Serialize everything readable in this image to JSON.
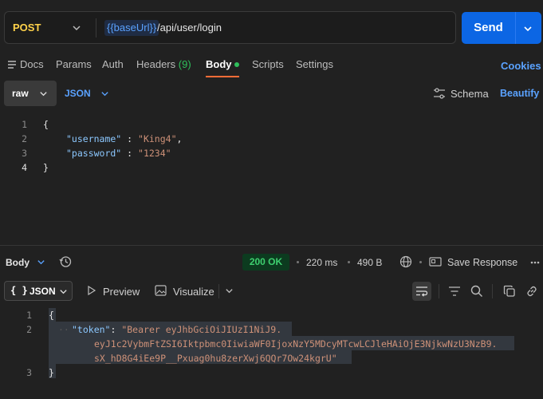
{
  "request": {
    "method": "POST",
    "url_variable": "{{baseUrl}}",
    "url_path": "/api/user/login",
    "send_label": "Send"
  },
  "tabs": {
    "docs": "Docs",
    "params": "Params",
    "auth": "Auth",
    "headers": "Headers",
    "headers_count": "(9)",
    "body": "Body",
    "scripts": "Scripts",
    "settings": "Settings",
    "cookies": "Cookies"
  },
  "body_options": {
    "mode": "raw",
    "format": "JSON",
    "schema": "Schema",
    "beautify": "Beautify"
  },
  "request_body": {
    "line_numbers": [
      "1",
      "2",
      "3",
      "4"
    ],
    "open_brace": "{",
    "username_key": "\"username\"",
    "username_value": "\"King4\"",
    "password_key": "\"password\"",
    "password_value": "\"1234\"",
    "sep": " : ",
    "comma": ",",
    "close_brace": "}"
  },
  "response_bar": {
    "label": "Body",
    "status": "200 OK",
    "time": "220 ms",
    "size": "490 B",
    "save_response": "Save Response"
  },
  "response_view": {
    "format": "JSON",
    "braces": "{ }",
    "preview": "Preview",
    "visualize": "Visualize"
  },
  "response_body": {
    "line_numbers": [
      "1",
      "2",
      "3"
    ],
    "open_brace": "{",
    "token_key": "\"token\"",
    "colon": ": ",
    "token_line1": "\"Bearer eyJhbGciOiJIUzI1NiJ9.",
    "token_line2": "eyJ1c2VybmFtZSI6Iktpbmc0IiwiaWF0IjoxNzY5MDcyMTcwLCJleHAiOjE3NjkwNzU3NzB9.",
    "token_line3": "sX_hD8G4iEe9P__Pxuag0hu8zerXwj6QQr7Ow24kgrU\"",
    "close_brace": "}"
  },
  "colors": {
    "background": "#212121",
    "accent_blue": "#0c66e4",
    "method_yellow": "#ffd24a",
    "status_green": "#3ed06f",
    "tab_underline": "#ff6c37"
  }
}
